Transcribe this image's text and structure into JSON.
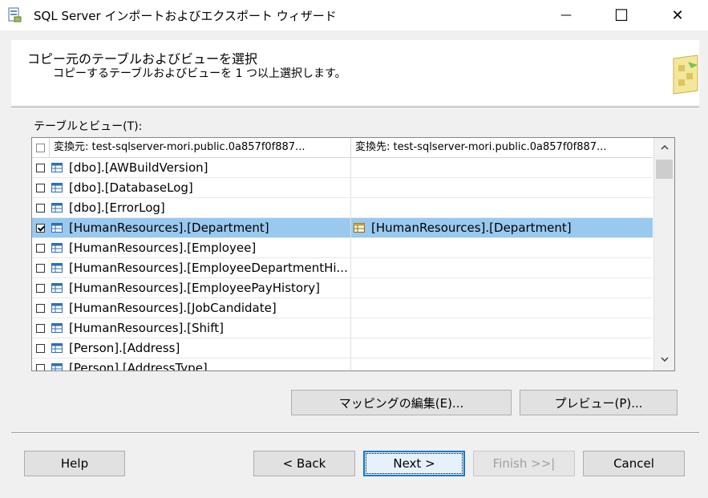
{
  "window": {
    "title": "SQL Server インポートおよびエクスポート ウィザード",
    "minimize_glyph": "—",
    "maximize_glyph": "☐",
    "close_glyph": "✕"
  },
  "header": {
    "title": "コピー元のテーブルおよびビューを選択",
    "subtitle": "コピーするテーブルおよびビューを 1 つ以上選択します。"
  },
  "list": {
    "label": "テーブルとビュー(T):",
    "columns": {
      "source": "変換元: test-sqlserver-mori.public.0a857f0f887...",
      "destination": "変換先: test-sqlserver-mori.public.0a857f0f887..."
    },
    "rows": [
      {
        "checked": false,
        "selected": false,
        "source": "[dbo].[AWBuildVersion]",
        "destination": ""
      },
      {
        "checked": false,
        "selected": false,
        "source": "[dbo].[DatabaseLog]",
        "destination": ""
      },
      {
        "checked": false,
        "selected": false,
        "source": "[dbo].[ErrorLog]",
        "destination": ""
      },
      {
        "checked": true,
        "selected": true,
        "source": "[HumanResources].[Department]",
        "destination": "[HumanResources].[Department]"
      },
      {
        "checked": false,
        "selected": false,
        "source": "[HumanResources].[Employee]",
        "destination": ""
      },
      {
        "checked": false,
        "selected": false,
        "source": "[HumanResources].[EmployeeDepartmentHi...",
        "destination": ""
      },
      {
        "checked": false,
        "selected": false,
        "source": "[HumanResources].[EmployeePayHistory]",
        "destination": ""
      },
      {
        "checked": false,
        "selected": false,
        "source": "[HumanResources].[JobCandidate]",
        "destination": ""
      },
      {
        "checked": false,
        "selected": false,
        "source": "[HumanResources].[Shift]",
        "destination": ""
      },
      {
        "checked": false,
        "selected": false,
        "source": "[Person].[Address]",
        "destination": ""
      },
      {
        "checked": false,
        "selected": false,
        "source": "[Person].[AddressType]",
        "destination": ""
      }
    ]
  },
  "actions": {
    "edit_mappings": "マッピングの編集(E)...",
    "preview": "プレビュー(P)..."
  },
  "footer": {
    "help": "Help",
    "back": "< Back",
    "next": "Next >",
    "finish": "Finish >>|",
    "cancel": "Cancel"
  },
  "colors": {
    "selection": "#99c9ef",
    "default_button_border": "#0078d7"
  }
}
